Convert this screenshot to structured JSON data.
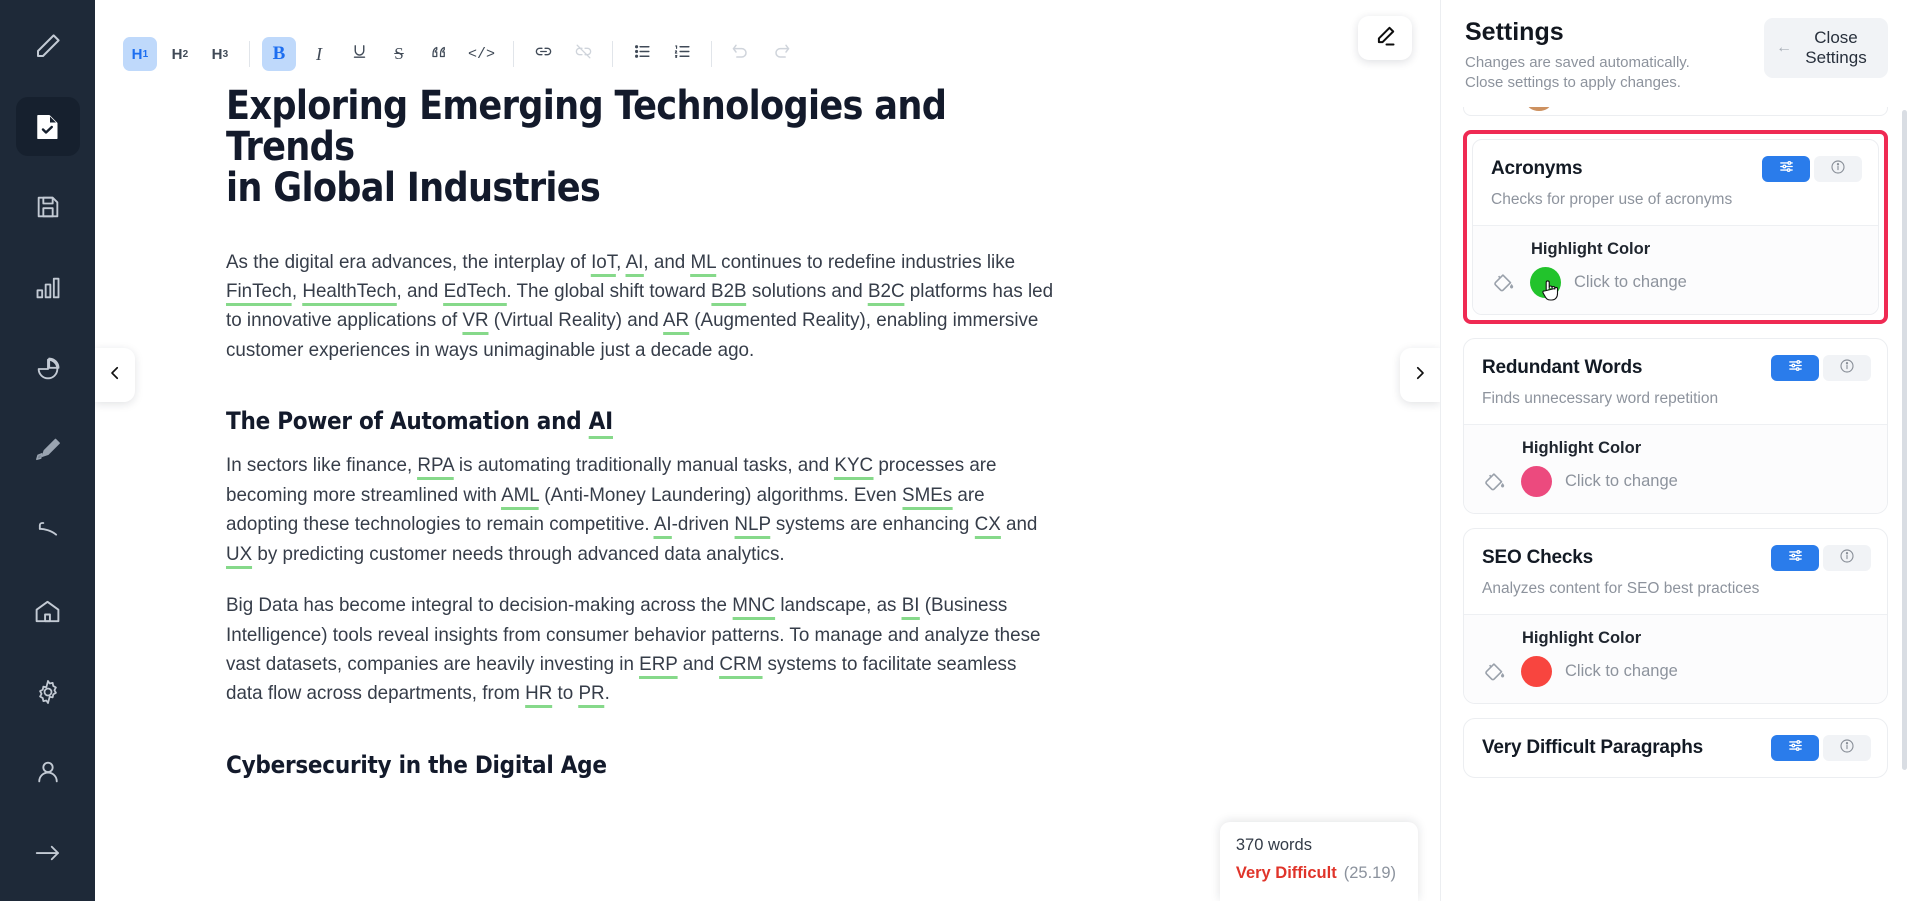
{
  "rail": {
    "items": [
      {
        "name": "pencil-icon",
        "label": "Edit",
        "active": false
      },
      {
        "name": "document-check-icon",
        "label": "Document",
        "active": true
      },
      {
        "name": "save-icon",
        "label": "Save",
        "active": false
      },
      {
        "name": "bar-chart-icon",
        "label": "Statistics",
        "active": false
      },
      {
        "name": "pie-chart-icon",
        "label": "Analytics",
        "active": false
      },
      {
        "name": "highlighter-icon",
        "label": "Highlighter",
        "active": false
      },
      {
        "name": "eraser-icon",
        "label": "Eraser",
        "active": false
      },
      {
        "name": "home-icon",
        "label": "Home",
        "active": false
      },
      {
        "name": "gear-icon",
        "label": "Settings",
        "active": false
      },
      {
        "name": "user-icon",
        "label": "Account",
        "active": false
      },
      {
        "name": "arrow-right-icon",
        "label": "Exit",
        "active": false
      }
    ]
  },
  "toolbar": {
    "h1": "H",
    "h1_sub": "1",
    "h2": "H",
    "h2_sub": "2",
    "h3": "H",
    "h3_sub": "3",
    "bold": "B",
    "italic": "I",
    "underline": "U",
    "strike": "S",
    "quote": "”",
    "code": "</>",
    "link": "link",
    "unlink": "unlink",
    "bullet_list": "bullet-list",
    "numbered_list": "numbered-list",
    "undo": "undo",
    "redo": "redo"
  },
  "editor": {
    "edit_fab": "pencil-icon",
    "prev_label": "‹",
    "next_label": "›",
    "title": "Exploring Emerging Technologies and Trends\nin Global Industries",
    "paragraph1_parts": [
      {
        "t": "As the digital era advances, the interplay of "
      },
      {
        "t": "IoT",
        "acr": true
      },
      {
        "t": ", "
      },
      {
        "t": "AI",
        "acr": true
      },
      {
        "t": ", and "
      },
      {
        "t": "ML",
        "acr": true
      },
      {
        "t": " continues to redefine industries like "
      },
      {
        "t": "FinTech",
        "acr": true
      },
      {
        "t": ", "
      },
      {
        "t": "HealthTech",
        "acr": true
      },
      {
        "t": ", and "
      },
      {
        "t": "EdTech",
        "acr": true
      },
      {
        "t": ". The global shift toward "
      },
      {
        "t": "B2B",
        "acr": true
      },
      {
        "t": " solutions and "
      },
      {
        "t": "B2C",
        "acr": true
      },
      {
        "t": " platforms has led to innovative applications of "
      },
      {
        "t": "VR",
        "acr": true
      },
      {
        "t": " (Virtual Reality) and "
      },
      {
        "t": "AR",
        "acr": true
      },
      {
        "t": " (Augmented Reality), enabling immersive customer experiences in ways unimaginable just a decade ago."
      }
    ],
    "heading2": "The Power of Automation and ",
    "heading2_acr": "AI",
    "paragraph2_parts": [
      {
        "t": "In sectors like finance, "
      },
      {
        "t": "RPA",
        "acr": true
      },
      {
        "t": " is automating traditionally manual tasks, and "
      },
      {
        "t": "KYC",
        "acr": true
      },
      {
        "t": " processes are becoming more streamlined with "
      },
      {
        "t": "AML",
        "acr": true
      },
      {
        "t": " (Anti-Money Laundering) algorithms. Even "
      },
      {
        "t": "SMEs",
        "acr": true
      },
      {
        "t": " are adopting these technologies to remain competitive. "
      },
      {
        "t": "AI",
        "acr": true
      },
      {
        "t": "-driven "
      },
      {
        "t": "NLP",
        "acr": true
      },
      {
        "t": " systems are enhancing "
      },
      {
        "t": "CX",
        "acr": true
      },
      {
        "t": " and "
      },
      {
        "t": "UX",
        "acr": true
      },
      {
        "t": " by predicting customer needs through advanced data analytics."
      }
    ],
    "paragraph3_parts": [
      {
        "t": "Big Data has become integral to decision-making across the "
      },
      {
        "t": "MNC",
        "acr": true
      },
      {
        "t": " landscape, as "
      },
      {
        "t": "BI",
        "acr": true
      },
      {
        "t": " (Business Intelligence) tools reveal insights from consumer behavior patterns. To manage and analyze these vast datasets, companies are heavily investing in "
      },
      {
        "t": "ERP",
        "acr": true
      },
      {
        "t": " and "
      },
      {
        "t": "CRM",
        "acr": true
      },
      {
        "t": " systems to facilitate seamless data flow across departments, from "
      },
      {
        "t": "HR",
        "acr": true
      },
      {
        "t": " to "
      },
      {
        "t": "PR",
        "acr": true
      },
      {
        "t": "."
      }
    ],
    "heading3": "Cybersecurity in the Digital Age"
  },
  "wordcount": {
    "words": "370 words",
    "difficulty": "Very Difficult",
    "score": "(25.19)",
    "difficulty_color": "#e0342a"
  },
  "settings": {
    "title": "Settings",
    "subtitle": "Changes are saved automatically.\nClose settings to apply changes.",
    "close_button": "Close Settings",
    "close_arrow": "←",
    "highlight_label": "Highlight Color",
    "highlight_hint": "Click to change",
    "highlight_border_color": "#ef2a53",
    "cards": [
      {
        "name": "Acronyms",
        "desc": "Checks for proper use of acronyms",
        "color": "#22c32c",
        "highlighted": true,
        "cursor": true
      },
      {
        "name": "Redundant Words",
        "desc": "Finds unnecessary word repetition",
        "color": "#ec4a7e",
        "highlighted": false,
        "cursor": false
      },
      {
        "name": "SEO Checks",
        "desc": "Analyzes content for SEO best practices",
        "color": "#f8453f",
        "highlighted": false,
        "cursor": false
      },
      {
        "name": "Very Difficult Paragraphs",
        "desc": "",
        "color": "",
        "highlighted": false,
        "cursor": false
      }
    ]
  }
}
